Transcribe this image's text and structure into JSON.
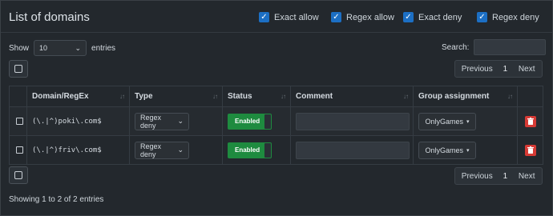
{
  "header": {
    "title": "List of domains",
    "filters": [
      {
        "label": "Exact allow",
        "checked": true
      },
      {
        "label": "Regex allow",
        "checked": true
      },
      {
        "label": "Exact deny",
        "checked": true
      },
      {
        "label": "Regex deny",
        "checked": true
      }
    ]
  },
  "controls": {
    "show_label": "Show",
    "entries_value": "10",
    "entries_label": "entries",
    "search_label": "Search:",
    "search_value": ""
  },
  "pagination": {
    "previous": "Previous",
    "page": "1",
    "next": "Next"
  },
  "table": {
    "columns": [
      "Domain/RegEx",
      "Type",
      "Status",
      "Comment",
      "Group assignment"
    ],
    "rows": [
      {
        "domain": "(\\.|^)poki\\.com$",
        "type": "Regex deny",
        "status": "Enabled",
        "comment": "",
        "group": "OnlyGames"
      },
      {
        "domain": "(\\.|^)friv\\.com$",
        "type": "Regex deny",
        "status": "Enabled",
        "comment": "",
        "group": "OnlyGames"
      }
    ]
  },
  "footer": {
    "info": "Showing 1 to 2 of 2 entries"
  },
  "colors": {
    "accent": "#1c6fc4",
    "enabled": "#1e8b3f",
    "danger": "#d63a35"
  }
}
